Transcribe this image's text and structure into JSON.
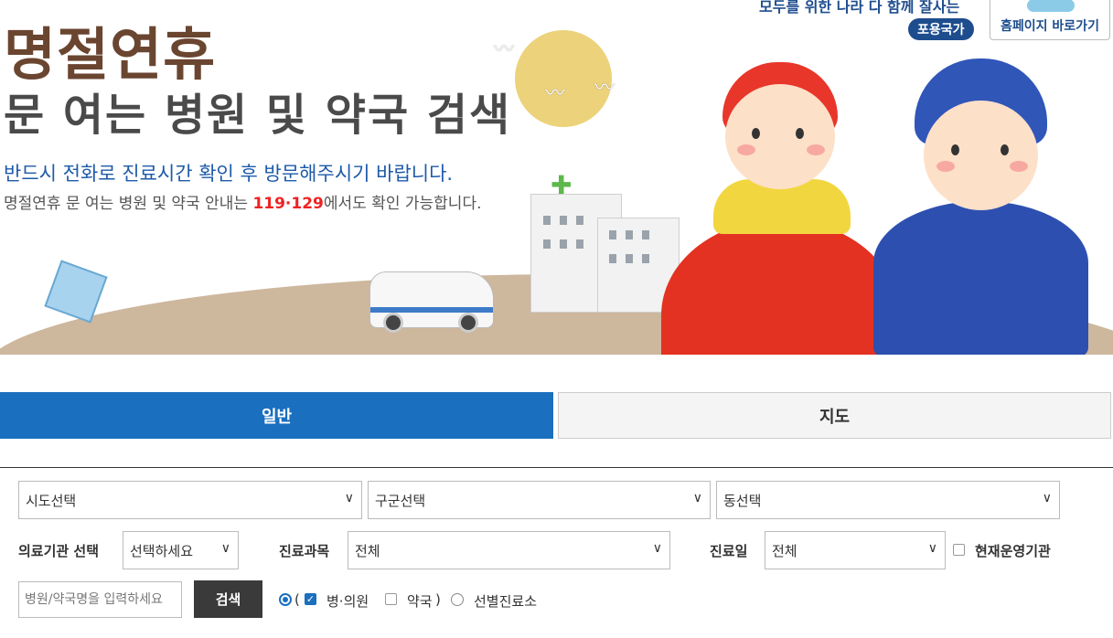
{
  "banner": {
    "title_line1": "명절연휴",
    "title_line2": "문 여는 병원 및 약국 검색",
    "notice": "반드시 전화로 진료시간 확인 후 방문해주시기 바랍니다.",
    "info_prefix": "명절연휴 문 여는 병원 및 약국 안내는 ",
    "info_numbers": "119·129",
    "info_suffix": "에서도 확인 가능합니다.",
    "slogan": "모두를 위한 나라 다 함께 잘사는",
    "slogan_badge": "포용국가",
    "homepage_button": "홈페이지 바로가기"
  },
  "tabs": [
    {
      "label": "일반",
      "active": true
    },
    {
      "label": "지도",
      "active": false
    }
  ],
  "filters": {
    "sido": "시도선택",
    "gugun": "구군선택",
    "dong": "동선택",
    "institution_label": "의료기관 선택",
    "institution_value": "선택하세요",
    "department_label": "진료과목",
    "department_value": "전체",
    "date_label": "진료일",
    "date_value": "전체",
    "open_now_label": "현재운영기관"
  },
  "search": {
    "placeholder": "병원/약국명을 입력하세요",
    "button_label": "검색",
    "paren_open": "(",
    "paren_close": ")",
    "options": {
      "clinic": "병·의원",
      "pharmacy": "약국",
      "screening": "선별진료소"
    }
  },
  "colors": {
    "primary": "#1a6fbf",
    "title_brown": "#6a4530",
    "notice_blue": "#1e5aa8",
    "highlight_red": "#e22222"
  }
}
